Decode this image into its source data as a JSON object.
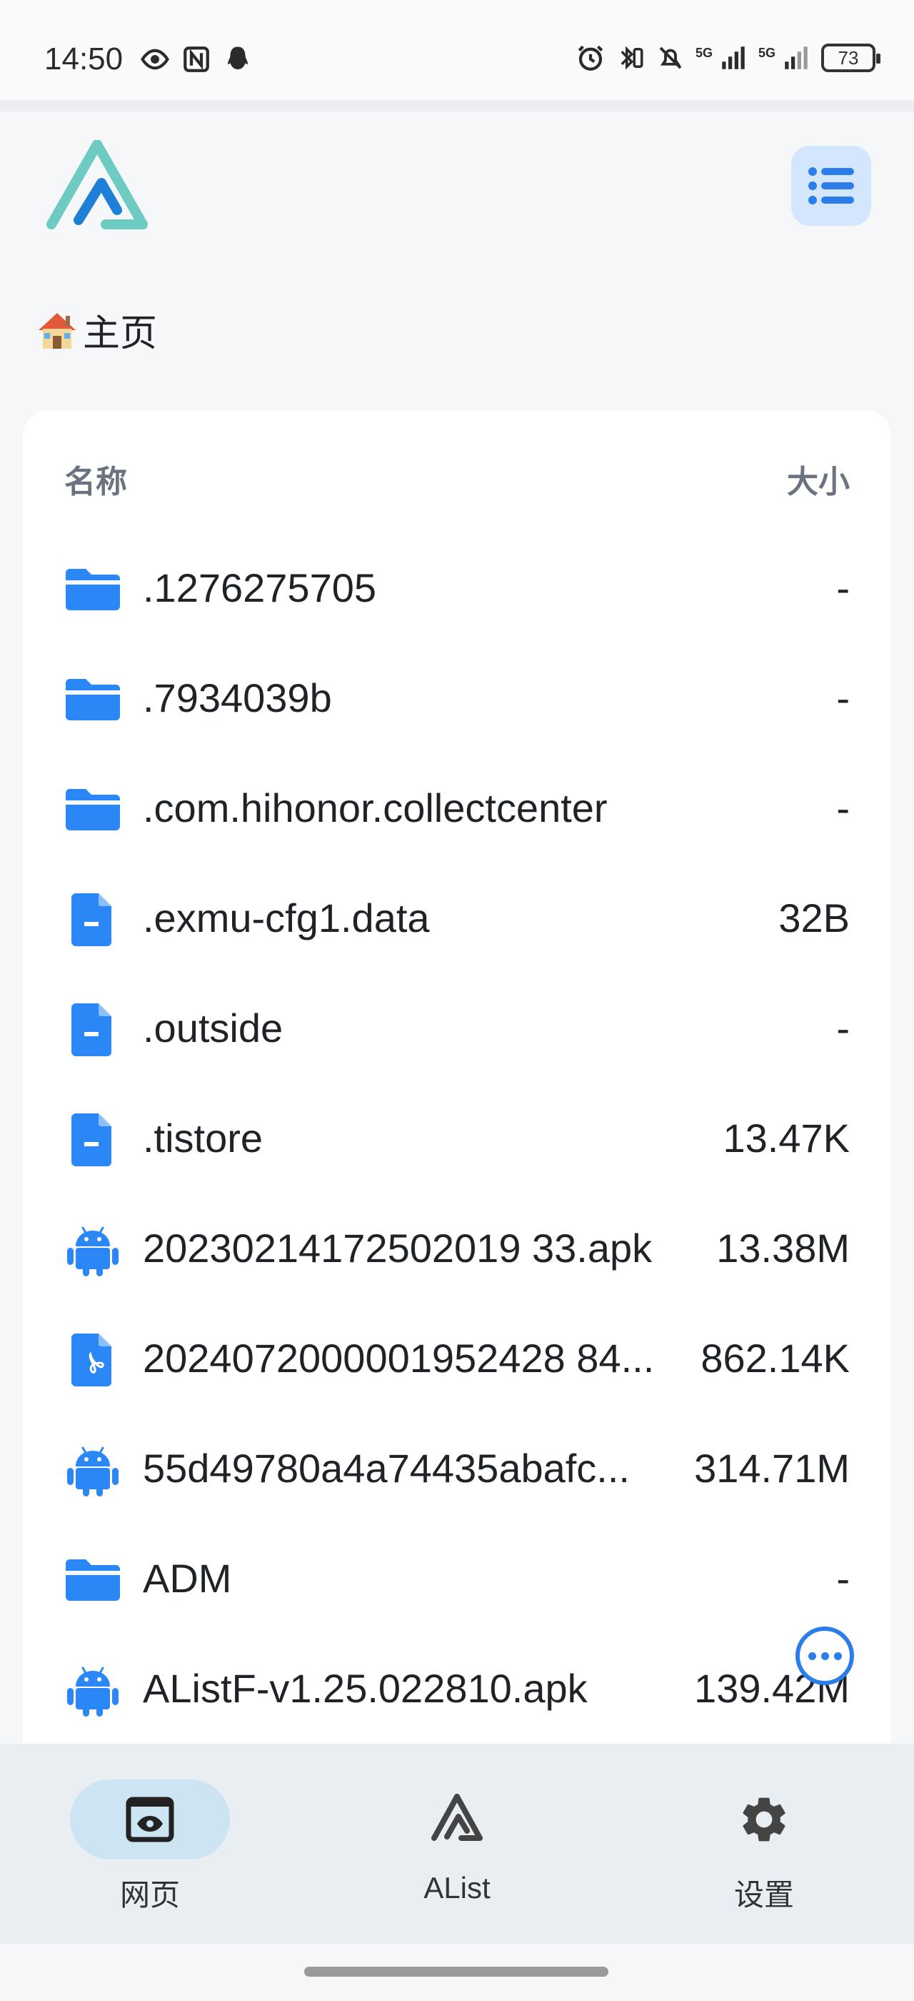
{
  "status_bar": {
    "time": "14:50",
    "signal1_label": "5G",
    "signal2_label": "5G",
    "battery": "73"
  },
  "header": {
    "breadcrumb": "主页"
  },
  "file_list": {
    "columns": {
      "name": "名称",
      "size": "大小"
    },
    "rows": [
      {
        "icon": "folder-icon",
        "name": ".1276275705",
        "size": "-"
      },
      {
        "icon": "folder-icon",
        "name": ".7934039b",
        "size": "-"
      },
      {
        "icon": "folder-icon",
        "name": ".com.hihonor.collectcenter",
        "size": "-"
      },
      {
        "icon": "file-icon",
        "name": ".exmu-cfg1.data",
        "size": "32B"
      },
      {
        "icon": "file-icon",
        "name": ".outside",
        "size": "-"
      },
      {
        "icon": "file-icon",
        "name": ".tistore",
        "size": "13.47K"
      },
      {
        "icon": "android-icon",
        "name": "20230214172502019 33.apk",
        "size": "13.38M"
      },
      {
        "icon": "pdf-icon",
        "name": "2024072000001952428 84...",
        "size": "862.14K"
      },
      {
        "icon": "android-icon",
        "name": "55d49780a4a74435abafc...",
        "size": "314.71M"
      },
      {
        "icon": "folder-icon",
        "name": "ADM",
        "size": "-"
      },
      {
        "icon": "android-icon",
        "name": "AListF-v1.25.022810.apk",
        "size": "139.42M"
      }
    ]
  },
  "bottom_nav": {
    "items": [
      {
        "label": "网页",
        "icon": "webview-icon",
        "active": true
      },
      {
        "label": "AList",
        "icon": "alist-logo-icon",
        "active": false
      },
      {
        "label": "设置",
        "icon": "gear-icon",
        "active": false
      }
    ]
  },
  "colors": {
    "accent": "#2b7de9",
    "folder": "#2b87f5",
    "nav_bg": "#e9eef2",
    "active_pill": "#cde4f3"
  }
}
